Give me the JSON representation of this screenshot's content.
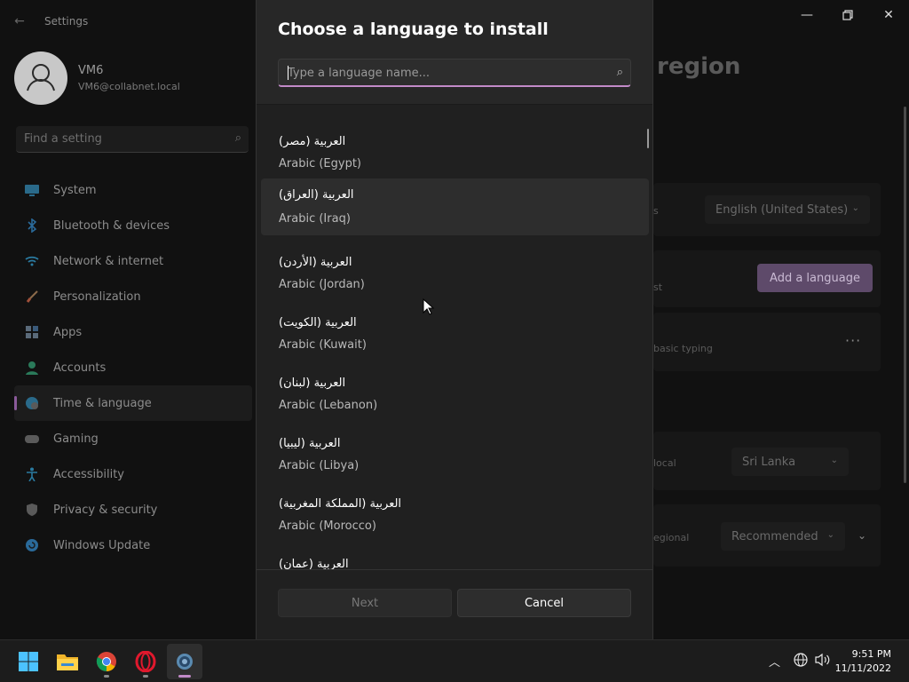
{
  "window": {
    "app_title": "Settings",
    "back_icon": "back-arrow-icon",
    "minimize_icon": "minimize-icon",
    "maximize_icon": "restore-icon",
    "close_icon": "close-icon"
  },
  "profile": {
    "name": "VM6",
    "email": "VM6@collabnet.local"
  },
  "search": {
    "placeholder": "Find a setting"
  },
  "sidebar": {
    "items": [
      {
        "label": "System",
        "icon": "system-icon"
      },
      {
        "label": "Bluetooth & devices",
        "icon": "bluetooth-icon"
      },
      {
        "label": "Network & internet",
        "icon": "wifi-icon"
      },
      {
        "label": "Personalization",
        "icon": "brush-icon"
      },
      {
        "label": "Apps",
        "icon": "apps-icon"
      },
      {
        "label": "Accounts",
        "icon": "account-icon"
      },
      {
        "label": "Time & language",
        "icon": "globe-clock-icon",
        "active": true
      },
      {
        "label": "Gaming",
        "icon": "gamepad-icon"
      },
      {
        "label": "Accessibility",
        "icon": "accessibility-icon"
      },
      {
        "label": "Privacy & security",
        "icon": "shield-icon"
      },
      {
        "label": "Windows Update",
        "icon": "update-icon"
      }
    ]
  },
  "main": {
    "heading_fragment": "region",
    "display_language_value": "English (United States)",
    "display_fragment": "s",
    "preferred_fragment": "st",
    "add_language_label": "Add a language",
    "basic_typing_fragment": "basic typing",
    "more_label": "···",
    "country_fragment": "local",
    "country_value": "Sri Lanka",
    "regional_fragment": "egional",
    "regional_format_value": "Recommended"
  },
  "dialog": {
    "title": "Choose a language to install",
    "search_placeholder": "Type a language name...",
    "languages": [
      {
        "native": "العربية (مصر)",
        "english": "Arabic (Egypt)"
      },
      {
        "native": "العربية (العراق)",
        "english": "Arabic (Iraq)",
        "hover": true
      },
      {
        "native": "العربية (الأردن)",
        "english": "Arabic (Jordan)"
      },
      {
        "native": "العربية (الكويت)",
        "english": "Arabic (Kuwait)"
      },
      {
        "native": "العربية (لبنان)",
        "english": "Arabic (Lebanon)"
      },
      {
        "native": "العربية (ليبيا)",
        "english": "Arabic (Libya)"
      },
      {
        "native": "العربية (المملكة المغربية)",
        "english": "Arabic (Morocco)"
      },
      {
        "native": "العربية (عمان)",
        "english": ""
      }
    ],
    "next_label": "Next",
    "cancel_label": "Cancel"
  },
  "taskbar": {
    "apps": [
      "start-icon",
      "file-explorer-icon",
      "chrome-icon",
      "opera-icon",
      "settings-icon"
    ],
    "time": "9:51 PM",
    "date": "11/11/2022"
  },
  "colors": {
    "accent": "#c28ac8",
    "dialog_bg": "#202020",
    "header_bg": "#272727"
  }
}
